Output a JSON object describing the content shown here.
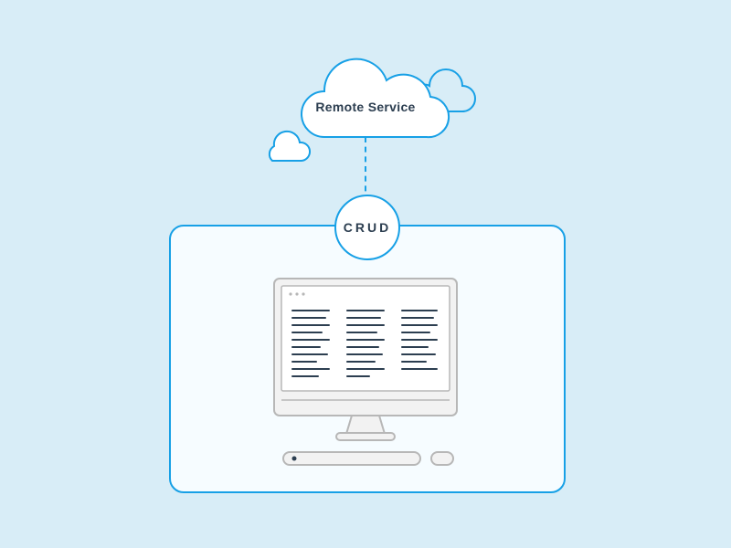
{
  "cloud": {
    "label": "Remote Service"
  },
  "connection": {
    "label": "CRUD"
  },
  "colors": {
    "background": "#d8edf7",
    "accent": "#17a0e6",
    "panel": "#f6fcff",
    "computer_fill": "#f2f2f2",
    "computer_stroke": "#b7b7b7",
    "text_dark": "#2c3e50"
  },
  "icons": {
    "cloud_main": "cloud-icon",
    "cloud_small_1": "cloud-icon",
    "cloud_small_2": "cloud-icon",
    "computer": "desktop-computer-icon",
    "keyboard": "keyboard-icon",
    "mouse": "mouse-icon"
  }
}
